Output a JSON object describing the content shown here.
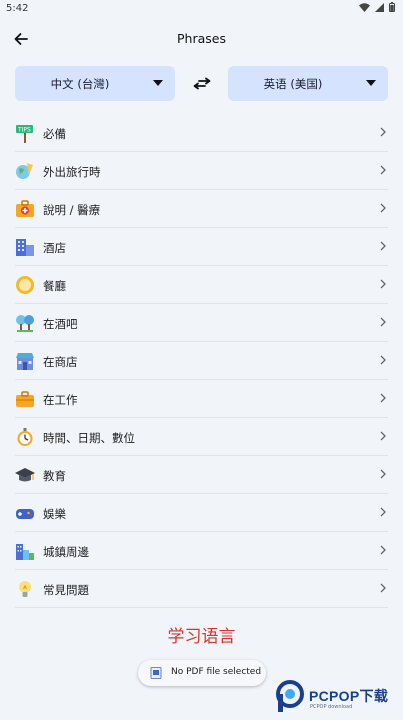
{
  "status": {
    "time": "5:42"
  },
  "app_bar": {
    "title": "Phrases"
  },
  "languages": {
    "source": "中文 (台灣)",
    "target": "英语 (美国)"
  },
  "categories": [
    {
      "label": "必備",
      "icon": "tips-sign-icon"
    },
    {
      "label": "外出旅行時",
      "icon": "travel-icon"
    },
    {
      "label": "說明 / 醫療",
      "icon": "first-aid-kit-icon"
    },
    {
      "label": "酒店",
      "icon": "hotel-icon"
    },
    {
      "label": "餐廳",
      "icon": "plate-icon"
    },
    {
      "label": "在酒吧",
      "icon": "bar-icon"
    },
    {
      "label": "在商店",
      "icon": "store-icon"
    },
    {
      "label": "在工作",
      "icon": "briefcase-icon"
    },
    {
      "label": "時間、日期、數位",
      "icon": "stopwatch-icon"
    },
    {
      "label": "教育",
      "icon": "graduation-cap-icon"
    },
    {
      "label": "娛樂",
      "icon": "gamepad-icon"
    },
    {
      "label": "城鎮周邊",
      "icon": "city-icon"
    },
    {
      "label": "常見問題",
      "icon": "lightbulb-icon"
    }
  ],
  "learn_label": "学习语言",
  "pdf_chip": {
    "text": "No PDF file selected"
  },
  "watermark": {
    "brand": "PCPOP下载",
    "sub": "PCPOP download"
  },
  "colors": {
    "accent": "#d6e3ff",
    "learn": "#d8352a",
    "background": "#f1f4f9"
  }
}
